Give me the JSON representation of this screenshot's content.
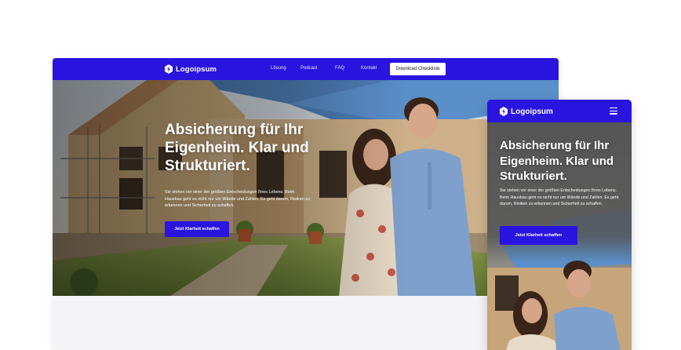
{
  "brand": {
    "name": "Logoipsum",
    "accent": "#2a14e0"
  },
  "desktop": {
    "nav": {
      "links": [
        "Lösung",
        "Podcast",
        "FAQ",
        "Kontakt"
      ],
      "cta_label": "Download Checkliste"
    },
    "hero": {
      "title": "Absicherung für Ihr Eigenheim. Klar und Strukturiert.",
      "text": "Sie stehen vor einer der größten Entscheidungen Ihres Lebens. Beim Hausbau geht es nicht nur um Wände und Zahlen. Es geht darum, Risiken zu erkennen und Sicherheit zu schaffen.",
      "button_label": "Jetzt Klarheit schaffen"
    }
  },
  "mobile": {
    "nav": {
      "menu_icon": "hamburger-menu-icon"
    },
    "hero": {
      "title": "Absicherung für Ihr Eigenheim. Klar und Strukturiert.",
      "text": "Sie stehen vor einer der größten Entscheidungen Ihres Lebens. Beim Hausbau geht es nicht nur um Wände und Zahlen. Es geht darum, Risiken zu erkennen und Sicherheit zu schaffen.",
      "button_label": "Jetzt Klarheit schaffen"
    }
  }
}
